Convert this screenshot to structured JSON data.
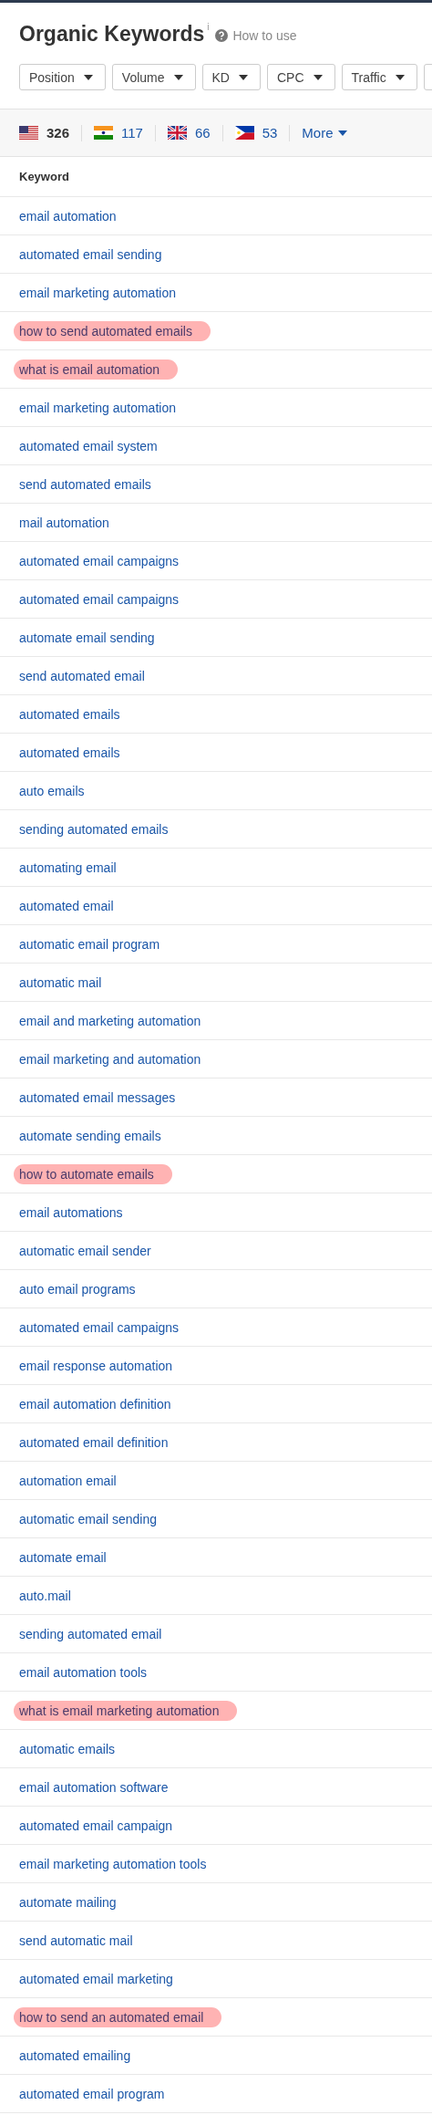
{
  "title": "Organic Keywords",
  "info_mark": "i",
  "help_link": "How to use",
  "filters": [
    {
      "label": "Position",
      "kind": "dropdown"
    },
    {
      "label": "Volume",
      "kind": "dropdown"
    },
    {
      "label": "KD",
      "kind": "dropdown"
    },
    {
      "label": "CPC",
      "kind": "dropdown"
    },
    {
      "label": "Traffic",
      "kind": "dropdown"
    },
    {
      "kind": "cut"
    }
  ],
  "countries": [
    {
      "kind": "us",
      "count": "326",
      "selected": true
    },
    {
      "kind": "in",
      "count": "117",
      "selected": false
    },
    {
      "kind": "gb",
      "count": "66",
      "selected": false
    },
    {
      "kind": "ph",
      "count": "53",
      "selected": false
    }
  ],
  "more": "More",
  "table": {
    "columns": [
      "Keyword"
    ],
    "rows": [
      {
        "keyword": "email automation",
        "highlighted": false
      },
      {
        "keyword": "automated email sending",
        "highlighted": false
      },
      {
        "keyword": "email marketing automation",
        "highlighted": false
      },
      {
        "keyword": "how to send automated emails",
        "highlighted": true
      },
      {
        "keyword": "what is email automation",
        "highlighted": true
      },
      {
        "keyword": "email marketing automation",
        "highlighted": false
      },
      {
        "keyword": "automated email system",
        "highlighted": false
      },
      {
        "keyword": "send automated emails",
        "highlighted": false
      },
      {
        "keyword": "mail automation",
        "highlighted": false
      },
      {
        "keyword": "automated email campaigns",
        "highlighted": false
      },
      {
        "keyword": "automated email campaigns",
        "highlighted": false
      },
      {
        "keyword": "automate email sending",
        "highlighted": false
      },
      {
        "keyword": "send automated email",
        "highlighted": false
      },
      {
        "keyword": "automated emails",
        "highlighted": false
      },
      {
        "keyword": "automated emails",
        "highlighted": false
      },
      {
        "keyword": "auto emails",
        "highlighted": false
      },
      {
        "keyword": "sending automated emails",
        "highlighted": false
      },
      {
        "keyword": "automating email",
        "highlighted": false
      },
      {
        "keyword": "automated email",
        "highlighted": false
      },
      {
        "keyword": "automatic email program",
        "highlighted": false
      },
      {
        "keyword": "automatic mail",
        "highlighted": false
      },
      {
        "keyword": "email and marketing automation",
        "highlighted": false
      },
      {
        "keyword": "email marketing and automation",
        "highlighted": false
      },
      {
        "keyword": "automated email messages",
        "highlighted": false
      },
      {
        "keyword": "automate sending emails",
        "highlighted": false
      },
      {
        "keyword": "how to automate emails",
        "highlighted": true
      },
      {
        "keyword": "email automations",
        "highlighted": false
      },
      {
        "keyword": "automatic email sender",
        "highlighted": false
      },
      {
        "keyword": "auto email programs",
        "highlighted": false
      },
      {
        "keyword": "automated email campaigns",
        "highlighted": false
      },
      {
        "keyword": "email response automation",
        "highlighted": false
      },
      {
        "keyword": "email automation definition",
        "highlighted": false
      },
      {
        "keyword": "automated email definition",
        "highlighted": false
      },
      {
        "keyword": "automation email",
        "highlighted": false
      },
      {
        "keyword": "automatic email sending",
        "highlighted": false
      },
      {
        "keyword": "automate email",
        "highlighted": false
      },
      {
        "keyword": "auto.mail",
        "highlighted": false
      },
      {
        "keyword": "sending automated email",
        "highlighted": false
      },
      {
        "keyword": "email automation tools",
        "highlighted": false
      },
      {
        "keyword": "what is email marketing automation",
        "highlighted": true
      },
      {
        "keyword": "automatic emails",
        "highlighted": false
      },
      {
        "keyword": "email automation software",
        "highlighted": false
      },
      {
        "keyword": "automated email campaign",
        "highlighted": false
      },
      {
        "keyword": "email marketing automation tools",
        "highlighted": false
      },
      {
        "keyword": "automate mailing",
        "highlighted": false
      },
      {
        "keyword": "send automatic mail",
        "highlighted": false
      },
      {
        "keyword": "automated email marketing",
        "highlighted": false
      },
      {
        "keyword": "how to send an automated email",
        "highlighted": true
      },
      {
        "keyword": "automated emailing",
        "highlighted": false
      },
      {
        "keyword": "automated email program",
        "highlighted": false
      }
    ]
  }
}
